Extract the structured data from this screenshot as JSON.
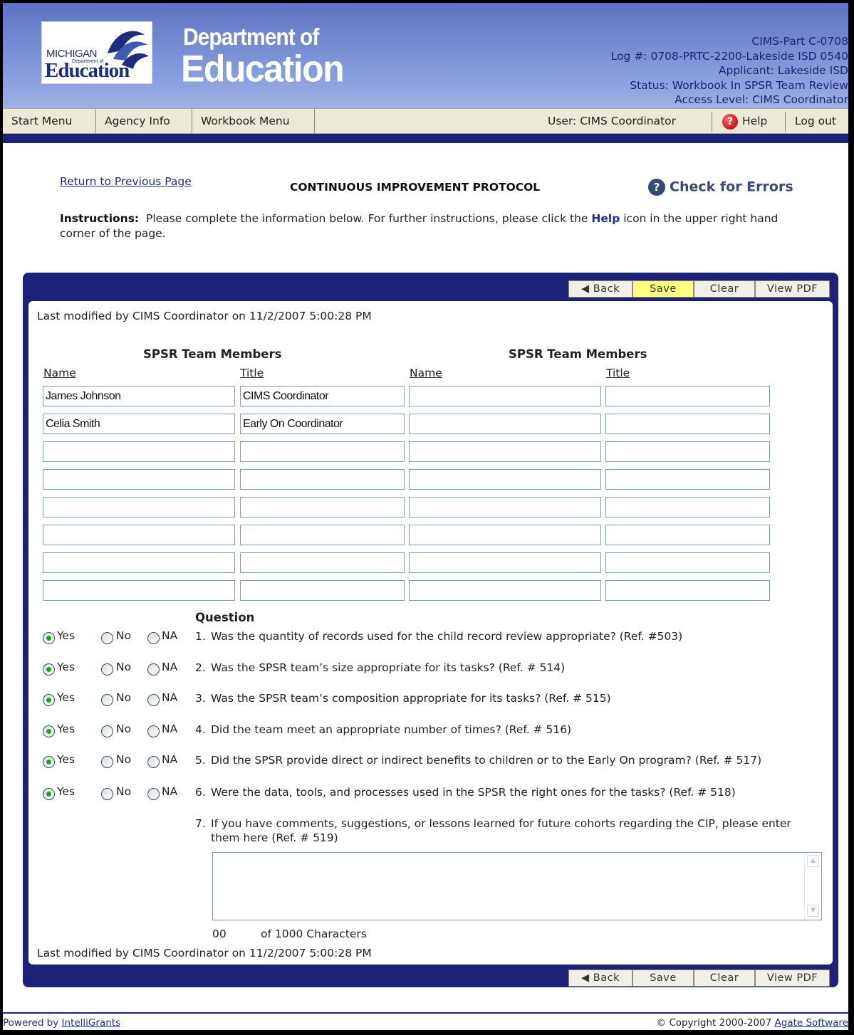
{
  "header": {
    "logo_state": "MICHIGAN",
    "logo_dept_small": "Department of",
    "logo_name": "Education",
    "dept_line1": "Department of",
    "dept_line2": "Education",
    "info": [
      "CIMS-Part C-0708",
      "Log #: 0708-PRTC-2200-Lakeside ISD 0540",
      "Applicant: Lakeside ISD",
      "Status: Workbook In SPSR Team Review",
      "Access Level: CIMS Coordinator"
    ]
  },
  "nav": {
    "start_menu": "Start Menu",
    "agency_info": "Agency Info",
    "workbook_menu": "Workbook Menu",
    "user": "User: CIMS Coordinator",
    "help": "Help",
    "logout": "Log out"
  },
  "page": {
    "return_link": "Return to Previous Page",
    "title": "CONTINUOUS IMPROVEMENT PROTOCOL",
    "check_errors": "Check for Errors",
    "instructions_label": "Instructions:",
    "instructions_part1": "Please complete the information below.  For further instructions, please click the",
    "instructions_help": "Help",
    "instructions_part2": "icon in the upper right hand corner of the page."
  },
  "toolbar": {
    "back": "Back",
    "save": "Save",
    "clear": "Clear",
    "view_pdf": "View PDF"
  },
  "modified_text": "Last modified by CIMS Coordinator on 11/2/2007 5:00:28 PM",
  "team": {
    "header": "SPSR Team Members",
    "name_label": "Name",
    "title_label": "Title",
    "left_rows": [
      {
        "name": "James Johnson",
        "title": "CIMS Coordinator"
      },
      {
        "name": "Celia Smith",
        "title": "Early On Coordinator"
      },
      {
        "name": "",
        "title": ""
      },
      {
        "name": "",
        "title": ""
      },
      {
        "name": "",
        "title": ""
      },
      {
        "name": "",
        "title": ""
      },
      {
        "name": "",
        "title": ""
      },
      {
        "name": "",
        "title": ""
      }
    ],
    "right_rows": [
      {
        "name": "",
        "title": ""
      },
      {
        "name": "",
        "title": ""
      },
      {
        "name": "",
        "title": ""
      },
      {
        "name": "",
        "title": ""
      },
      {
        "name": "",
        "title": ""
      },
      {
        "name": "",
        "title": ""
      },
      {
        "name": "",
        "title": ""
      },
      {
        "name": "",
        "title": ""
      }
    ]
  },
  "questions": {
    "header": "Question",
    "yes": "Yes",
    "no": "No",
    "na": "NA",
    "items": [
      {
        "num": "1.",
        "text": "Was the quantity of records used for the child record review appropriate? (Ref. #503)",
        "answer": "Yes"
      },
      {
        "num": "2.",
        "text": "Was the SPSR team’s size appropriate for its tasks? (Ref. # 514)",
        "answer": "Yes"
      },
      {
        "num": "3.",
        "text": "Was the SPSR team’s composition appropriate for its tasks? (Ref. # 515)",
        "answer": "Yes"
      },
      {
        "num": "4.",
        "text": "Did the team meet an appropriate number of times? (Ref. # 516)",
        "answer": "Yes"
      },
      {
        "num": "5.",
        "text": "Did the SPSR provide direct or indirect benefits to children or to the Early On program? (Ref. # 517)",
        "answer": "Yes"
      },
      {
        "num": "6.",
        "text": "Were the data, tools, and processes used in the SPSR the right ones for the tasks? (Ref. # 518)",
        "answer": "Yes"
      }
    ],
    "q7_num": "7.",
    "q7_text": "If you have comments, suggestions, or lessons learned for future cohorts regarding the CIP, please enter them here (Ref. # 519)",
    "comments_value": "",
    "char_count": "00",
    "char_limit_text": "of 1000 Characters"
  },
  "footer": {
    "powered_prefix": "Powered by",
    "powered_link": "IntelliGrants",
    "copyright_prefix": "© Copyright 2000-2007",
    "copyright_link": "Agate Software"
  }
}
